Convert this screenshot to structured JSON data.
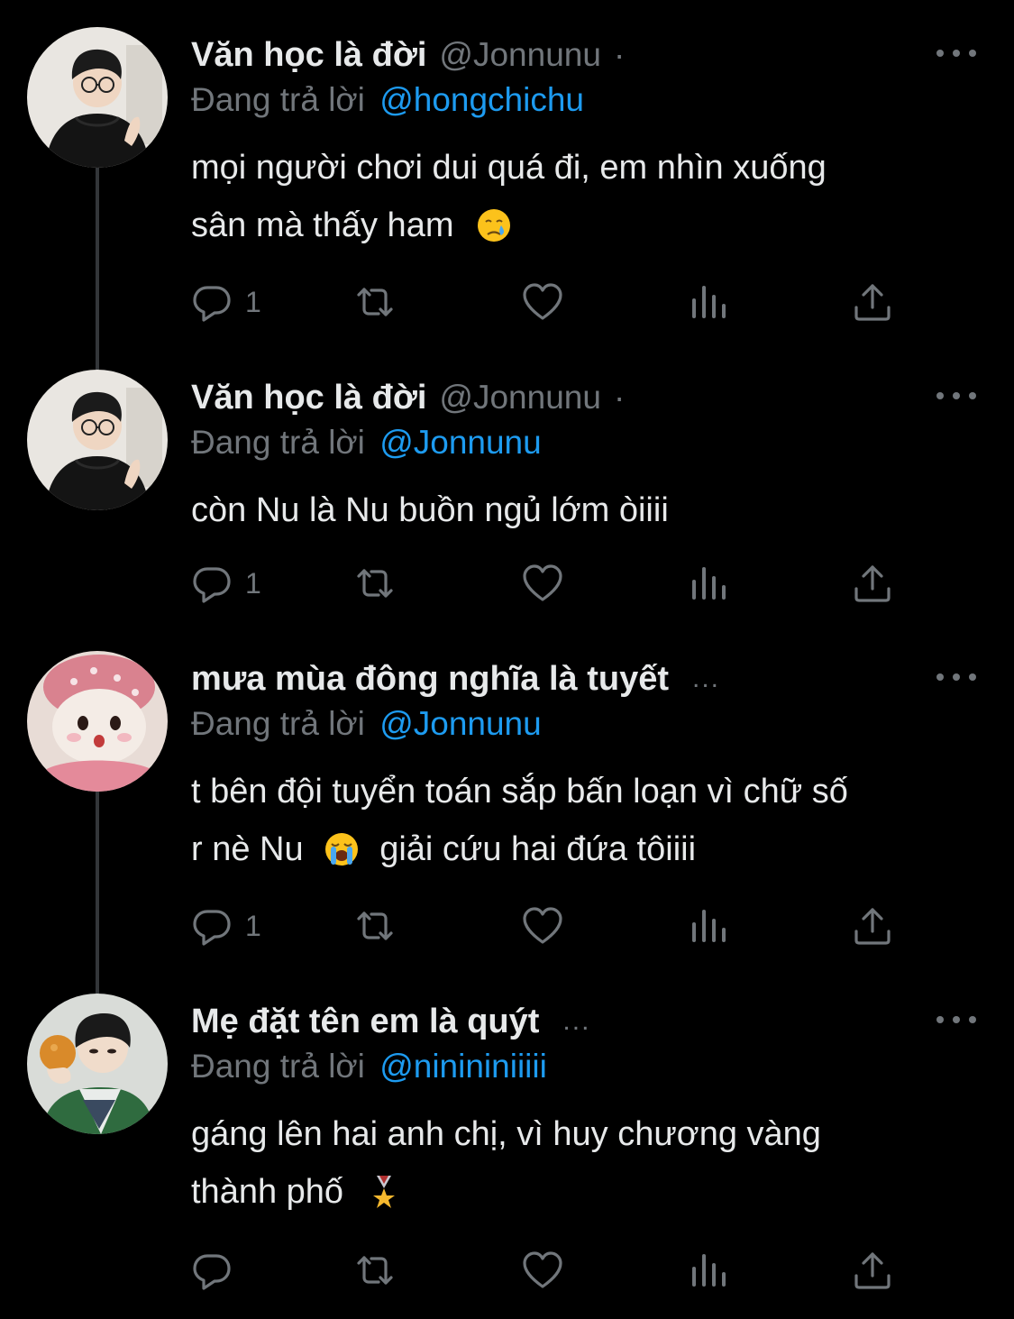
{
  "reply_prefix": "Đang trả lời",
  "tweets": [
    {
      "name": "Văn học là đời",
      "handle": "@Jonnunu",
      "separator": "·",
      "reply_to": "@hongchichu",
      "lines": [
        "mọi người chơi dui quá đi, em nhìn xuống",
        "sân mà thấy ham"
      ],
      "emoji": "crying-face-emoji",
      "reply_count": "1",
      "avatar": "boy-glasses-black-hoodie"
    },
    {
      "name": "Văn học là đời",
      "handle": "@Jonnunu",
      "separator": "·",
      "reply_to": "@Jonnunu",
      "lines": [
        "còn Nu là Nu buồn ngủ lớm òiiii"
      ],
      "reply_count": "1",
      "avatar": "boy-glasses-black-hoodie"
    },
    {
      "name": "mưa mùa đông nghĩa là tuyết",
      "truncation": "...",
      "reply_to": "@Jonnunu",
      "lines": [
        "t bên đội tuyển toán sắp bấn loạn vì chữ số",
        "r nè Nu",
        "giải cứu hai đứa tôiiii"
      ],
      "emoji": "loudly-crying-face-emoji",
      "reply_count": "1",
      "avatar": "pink-plush-toy"
    },
    {
      "name": "Mẹ đặt tên em là quýt",
      "truncation": "...",
      "reply_to": "@ninininiiiii",
      "lines": [
        "gáng lên hai anh chị, vì huy chương vàng",
        "thành phố"
      ],
      "emoji": "military-medal-emoji",
      "reply_count": "",
      "avatar": "boy-holding-orange"
    }
  ],
  "colors": {
    "background": "#000000",
    "text": "#e7e9ea",
    "secondary": "#71767b",
    "link": "#1d9bf0",
    "thread_line": "#333639"
  }
}
